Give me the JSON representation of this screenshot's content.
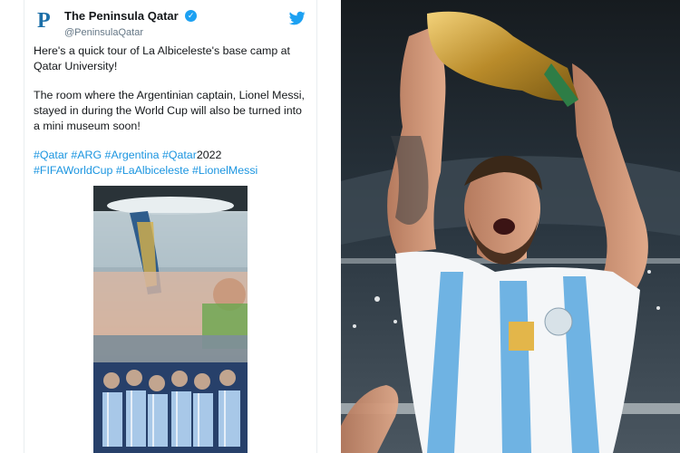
{
  "tweet": {
    "display_name": "The Peninsula Qatar",
    "handle": "@PeninsulaQatar",
    "avatar_letter": "P",
    "paragraph1": "Here's a quick tour of La Albiceleste's base camp at Qatar University!",
    "paragraph2": "The room where the Argentinian captain, Lionel Messi, stayed in during the World Cup will also be turned into a mini museum soon!",
    "hashtag_line1": {
      "tags": [
        "#Qatar",
        "#ARG",
        "#Argentina",
        "#Qatar"
      ],
      "suffix": "2022"
    },
    "hashtag_line2": {
      "tags": [
        "#FIFAWorldCup",
        "#LaAlbiceleste",
        "#LionelMessi"
      ]
    }
  },
  "colors": {
    "link": "#1b95e0",
    "verified": "#1da1f2",
    "brand_logo": "#1c6fa8"
  },
  "icons": {
    "verified": "verified-badge-icon",
    "bird": "twitter-bird-icon"
  }
}
